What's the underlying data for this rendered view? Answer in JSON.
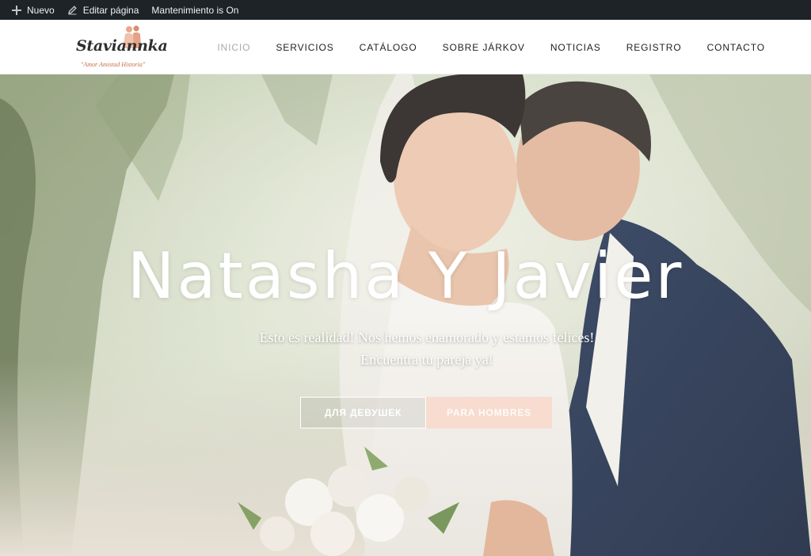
{
  "adminbar": {
    "new_label": "Nuevo",
    "edit_label": "Editar página",
    "maintenance_label": "Mantenimiento is On"
  },
  "logo": {
    "name": "Staviannka",
    "tagline": "\"Amor Amistad Historia\""
  },
  "nav": {
    "items": [
      "INICIO",
      "SERVICIOS",
      "CATÁLOGO",
      "SOBRE JÁRKOV",
      "NOTICIAS",
      "REGISTRO",
      "CONTACTO"
    ],
    "active_index": 0
  },
  "hero": {
    "title": "Natasha Y Javier",
    "subtitle_line1": "Esto es realidad! Nos hemos enamorado y estamos felices!",
    "subtitle_line2": "Encuentra tu pareja ya!",
    "button_girls": "ДЛЯ ДЕВУШЕК",
    "button_men": "PARA HOMBRES"
  },
  "colors": {
    "adminbar_bg": "#1d2327",
    "accent_peach": "#f7dccf",
    "logo_tag": "#c4704a",
    "nav_active": "#aaaaaa"
  }
}
